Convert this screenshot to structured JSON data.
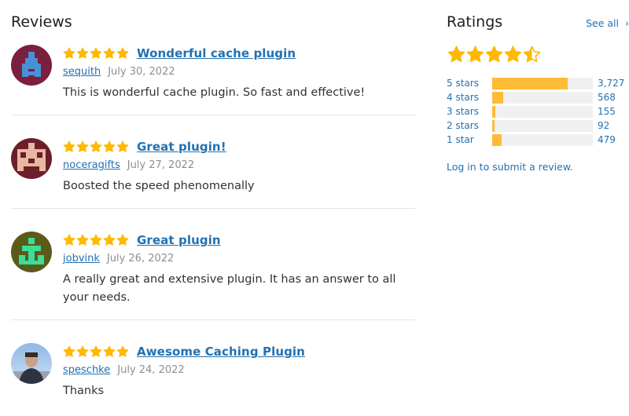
{
  "reviews": {
    "heading": "Reviews",
    "items": [
      {
        "rating": 5,
        "title": "Wonderful cache plugin",
        "author": "sequith",
        "date": "July 30, 2022",
        "content": "This is wonderful cache plugin. So fast and effective!",
        "avatar": "identicon-avatar"
      },
      {
        "rating": 5,
        "title": "Great plugin!",
        "author": "noceragifts",
        "date": "July 27, 2022",
        "content": "Boosted the speed phenomenally",
        "avatar": "identicon-avatar"
      },
      {
        "rating": 5,
        "title": "Great plugin",
        "author": "jobvink",
        "date": "July 26, 2022",
        "content": "A really great and extensive plugin. It has an answer to all your needs.",
        "avatar": "identicon-avatar"
      },
      {
        "rating": 5,
        "title": "Awesome Caching Plugin",
        "author": "speschke",
        "date": "July 24, 2022",
        "content": "Thanks",
        "avatar": "photo-avatar"
      }
    ]
  },
  "ratings": {
    "heading": "Ratings",
    "see_all": "See all",
    "see_all_icon": "chevron-right-icon",
    "average_stars": 4.5,
    "bars": [
      {
        "label": "5 stars",
        "count": "3,727",
        "fraction": 0.75
      },
      {
        "label": "4 stars",
        "count": "568",
        "fraction": 0.11
      },
      {
        "label": "3 stars",
        "count": "155",
        "fraction": 0.03
      },
      {
        "label": "2 stars",
        "count": "92",
        "fraction": 0.02
      },
      {
        "label": "1 star",
        "count": "479",
        "fraction": 0.09
      }
    ],
    "login_prompt": "Log in to submit a review."
  },
  "colors": {
    "star": "#ffb900",
    "link": "#2271b1",
    "bar_fill": "#ffbb36",
    "bar_track": "#f0f0f1"
  }
}
